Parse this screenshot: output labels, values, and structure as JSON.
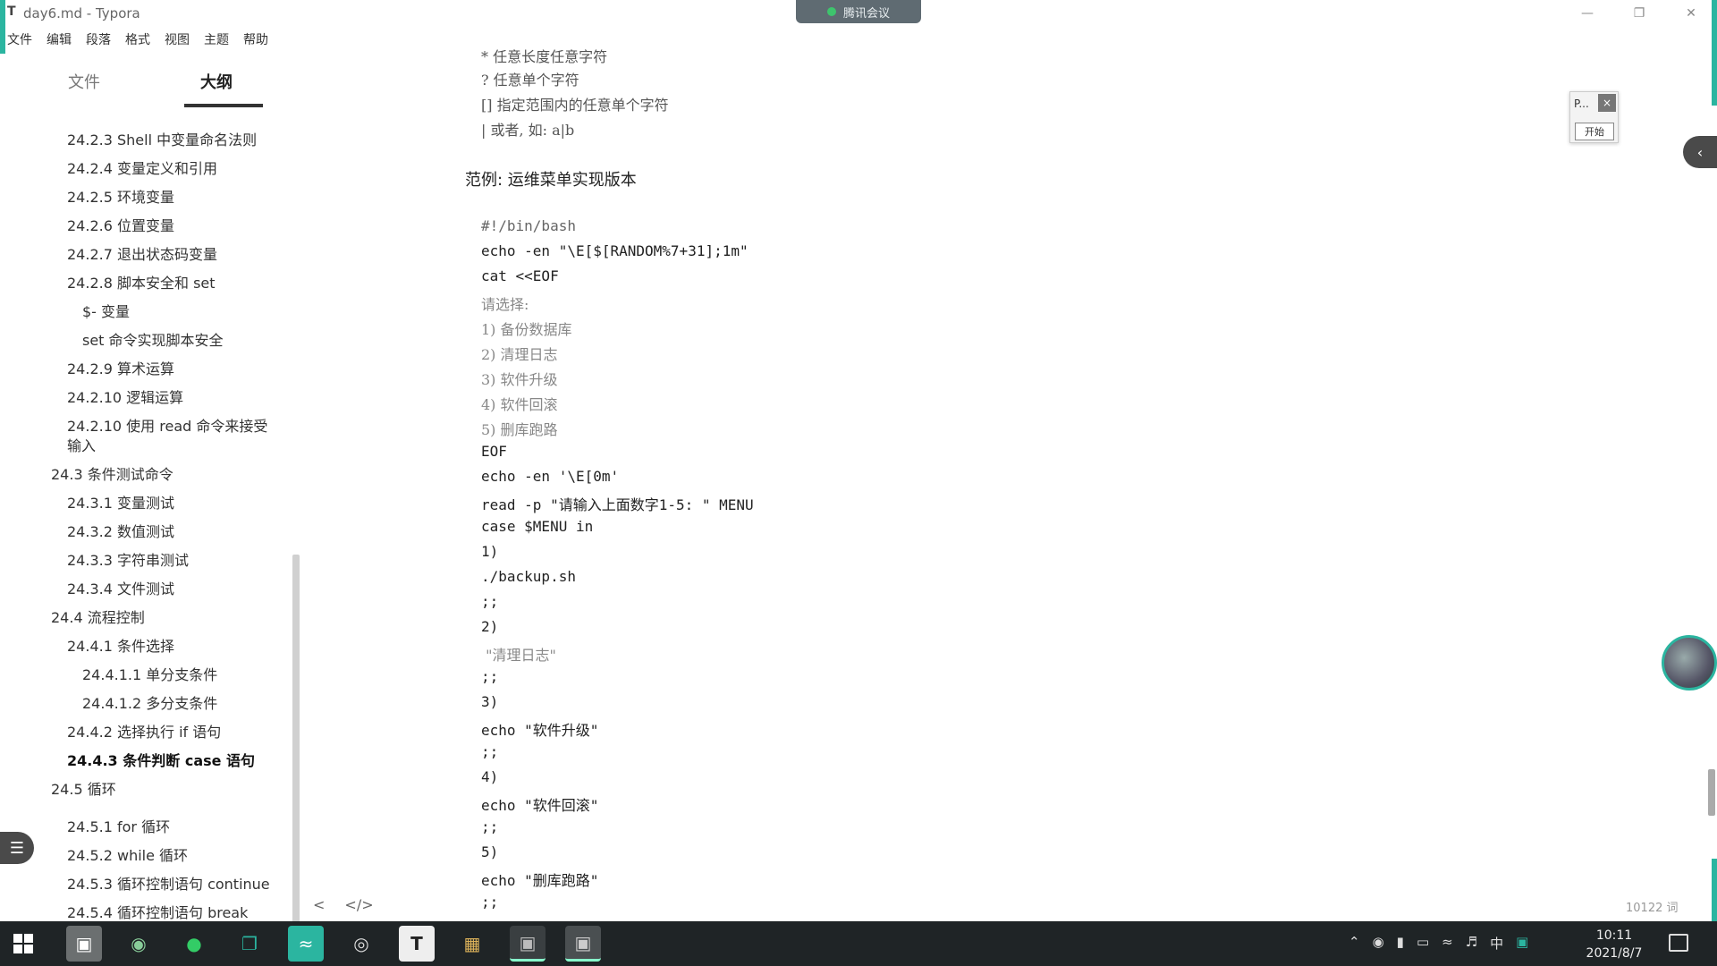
{
  "window": {
    "title": "day6.md - Typora",
    "app_icon": "T",
    "meeting_label": "腾讯会议"
  },
  "menu": [
    "文件",
    "编辑",
    "段落",
    "格式",
    "视图",
    "主题",
    "帮助"
  ],
  "sidebar": {
    "tab_files": "文件",
    "tab_outline": "大纲",
    "items": [
      {
        "text": "24.2.3 Shell 中变量命名法则",
        "level": 3
      },
      {
        "text": "24.2.4 变量定义和引用",
        "level": 3
      },
      {
        "text": "24.2.5 环境变量",
        "level": 3
      },
      {
        "text": "24.2.6 位置变量",
        "level": 3
      },
      {
        "text": "24.2.7 退出状态码变量",
        "level": 3
      },
      {
        "text": "24.2.8 脚本安全和 set",
        "level": 3
      },
      {
        "text": "$- 变量",
        "level": 4
      },
      {
        "text": "set 命令实现脚本安全",
        "level": 4
      },
      {
        "text": "24.2.9 算术运算",
        "level": 3
      },
      {
        "text": "24.2.10 逻辑运算",
        "level": 3
      },
      {
        "text": "24.2.10 使用 read 命令来接受",
        "level": 3
      },
      {
        "text": "输入",
        "level": 3
      },
      {
        "text": "24.3 条件测试命令",
        "level": 2
      },
      {
        "text": "24.3.1 变量测试",
        "level": 3
      },
      {
        "text": "24.3.2 数值测试",
        "level": 3
      },
      {
        "text": "24.3.3 字符串测试",
        "level": 3
      },
      {
        "text": "24.3.4 文件测试",
        "level": 3
      },
      {
        "text": "24.4 流程控制",
        "level": 2
      },
      {
        "text": "24.4.1 条件选择",
        "level": 3
      },
      {
        "text": "24.4.1.1 单分支条件",
        "level": 4
      },
      {
        "text": "24.4.1.2 多分支条件",
        "level": 4
      },
      {
        "text": "24.4.2 选择执行 if 语句",
        "level": 3
      },
      {
        "text": "24.4.3 条件判断 case 语句",
        "level": 3,
        "active": true
      },
      {
        "text": "24.5 循环",
        "level": 2
      },
      {
        "text": "24.5.1 for 循环",
        "level": 3
      },
      {
        "text": "24.5.2 while 循环",
        "level": 3
      },
      {
        "text": "24.5.3 循环控制语句 continue",
        "level": 3
      },
      {
        "text": "24.5.4 循环控制语句 break",
        "level": 3
      }
    ],
    "footer_back": "<",
    "footer_source": "</>"
  },
  "editor": {
    "top_lines": [
      "* 任意长度任意字符",
      "? 任意单个字符",
      "[] 指定范围内的任意单个字符",
      "| 或者, 如: a|b"
    ],
    "heading": "范例: 运维菜单实现版本",
    "code_lines": [
      "#!/bin/bash",
      "echo -en \"\\E[$[RANDOM%7+31];1m\"",
      "cat <<EOF",
      "请选择:",
      "1) 备份数据库",
      "2) 清理日志",
      "3) 软件升级",
      "4) 软件回滚",
      "5) 删库跑路",
      "EOF",
      "echo -en '\\E[0m'",
      "read -p \"请输入上面数字1-5: \" MENU",
      "case $MENU in",
      "1)",
      "./backup.sh",
      ";;",
      "2)",
      " \"清理日志\"",
      ";;",
      "3)",
      "echo \"软件升级\"",
      ";;",
      "4)",
      "echo \"软件回滚\"",
      ";;",
      "5)",
      "echo \"删库跑路\"",
      ";;"
    ],
    "word_count": "10122 词"
  },
  "widget": {
    "label": "P...",
    "close": "×",
    "start": "开始"
  },
  "taskbar": {
    "ime": "中",
    "time": "10:11",
    "date": "2021/8/7"
  },
  "colors": {
    "accent": "#2bb5a0",
    "taskbar_bg": "#1f2426",
    "string": "#a0522d"
  }
}
